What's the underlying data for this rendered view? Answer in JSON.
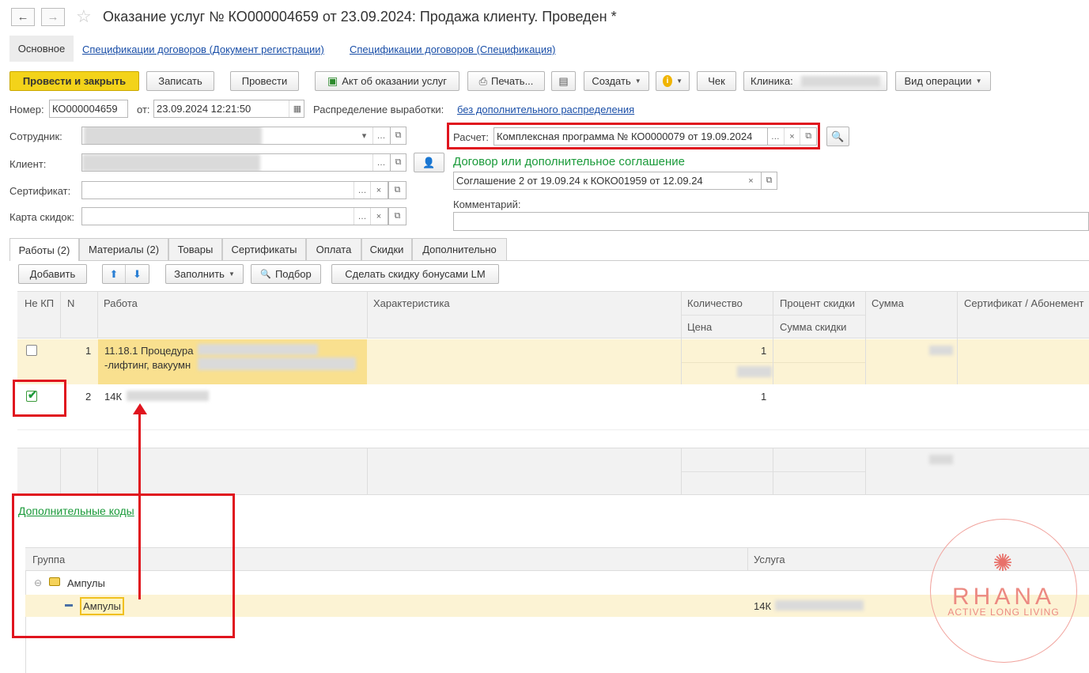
{
  "header": {
    "title": "Оказание услуг № КО000004659 от 23.09.2024: Продажа клиенту.  Проведен *",
    "back_label": "←",
    "forward_label": "→",
    "star": "☆"
  },
  "nav_tabs": [
    "Основное",
    "Спецификации договоров (Документ регистрации)",
    "Спецификации договоров (Спецификация)"
  ],
  "toolbar": {
    "post_close": "Провести и закрыть",
    "save": "Записать",
    "post": "Провести",
    "act": "Акт об оказании услуг",
    "print": "Печать...",
    "create": "Создать",
    "check": "Чек",
    "clinic": "Клиника:",
    "operation": "Вид операции"
  },
  "form": {
    "number_label": "Номер:",
    "number_value": "КО000004659",
    "from_label": "от:",
    "date_value": "23.09.2024 12:21:50",
    "distribution_label": "Распределение выработки:",
    "distribution_value": "без дополнительного распределения",
    "employee_label": "Сотрудник:",
    "client_label": "Клиент:",
    "certificate_label": "Сертификат:",
    "discount_card_label": "Карта скидок:",
    "calc_label": "Расчет:",
    "calc_value": "Комплексная программа № КО0000079 от 19.09.2024",
    "contract_heading": "Договор или дополнительное соглашение",
    "contract_value": "Соглашение 2 от 19.09.24 к КОКО01959 от 12.09.24",
    "comment_label": "Комментарий:"
  },
  "tabs": [
    "Работы (2)",
    "Материалы (2)",
    "Товары",
    "Сертификаты",
    "Оплата",
    "Скидки",
    "Дополнительно"
  ],
  "table_toolbar": {
    "add": "Добавить",
    "fill": "Заполнить",
    "pick": "Подбор",
    "discount": "Сделать скидку бонусами LM"
  },
  "table": {
    "headers": {
      "not_kp": "Не КП",
      "n": "N",
      "work": "Работа",
      "characteristic": "Характеристика",
      "quantity": "Количество",
      "price": "Цена",
      "discount_pct": "Процент скидки",
      "discount_sum": "Сумма скидки",
      "sum": "Сумма",
      "certificate": "Сертификат / Абонемент"
    },
    "rows": [
      {
        "n": "1",
        "work_line1": "11.18.1 Процедура",
        "work_line2": "-лифтинг, вакуумн",
        "quantity": "1",
        "checked": false
      },
      {
        "n": "2",
        "work_line1": "14К",
        "quantity": "1",
        "checked": true
      }
    ]
  },
  "extra": {
    "link": "Дополнительные коды",
    "group_header": "Группа",
    "service_header": "Услуга",
    "group_parent": "Ампулы",
    "group_child": "Ампулы",
    "service_value": "14К"
  },
  "watermark": {
    "brand": "RHANA",
    "tagline": "ACTIVE LONG LIVING",
    "color": "#e8716a"
  }
}
